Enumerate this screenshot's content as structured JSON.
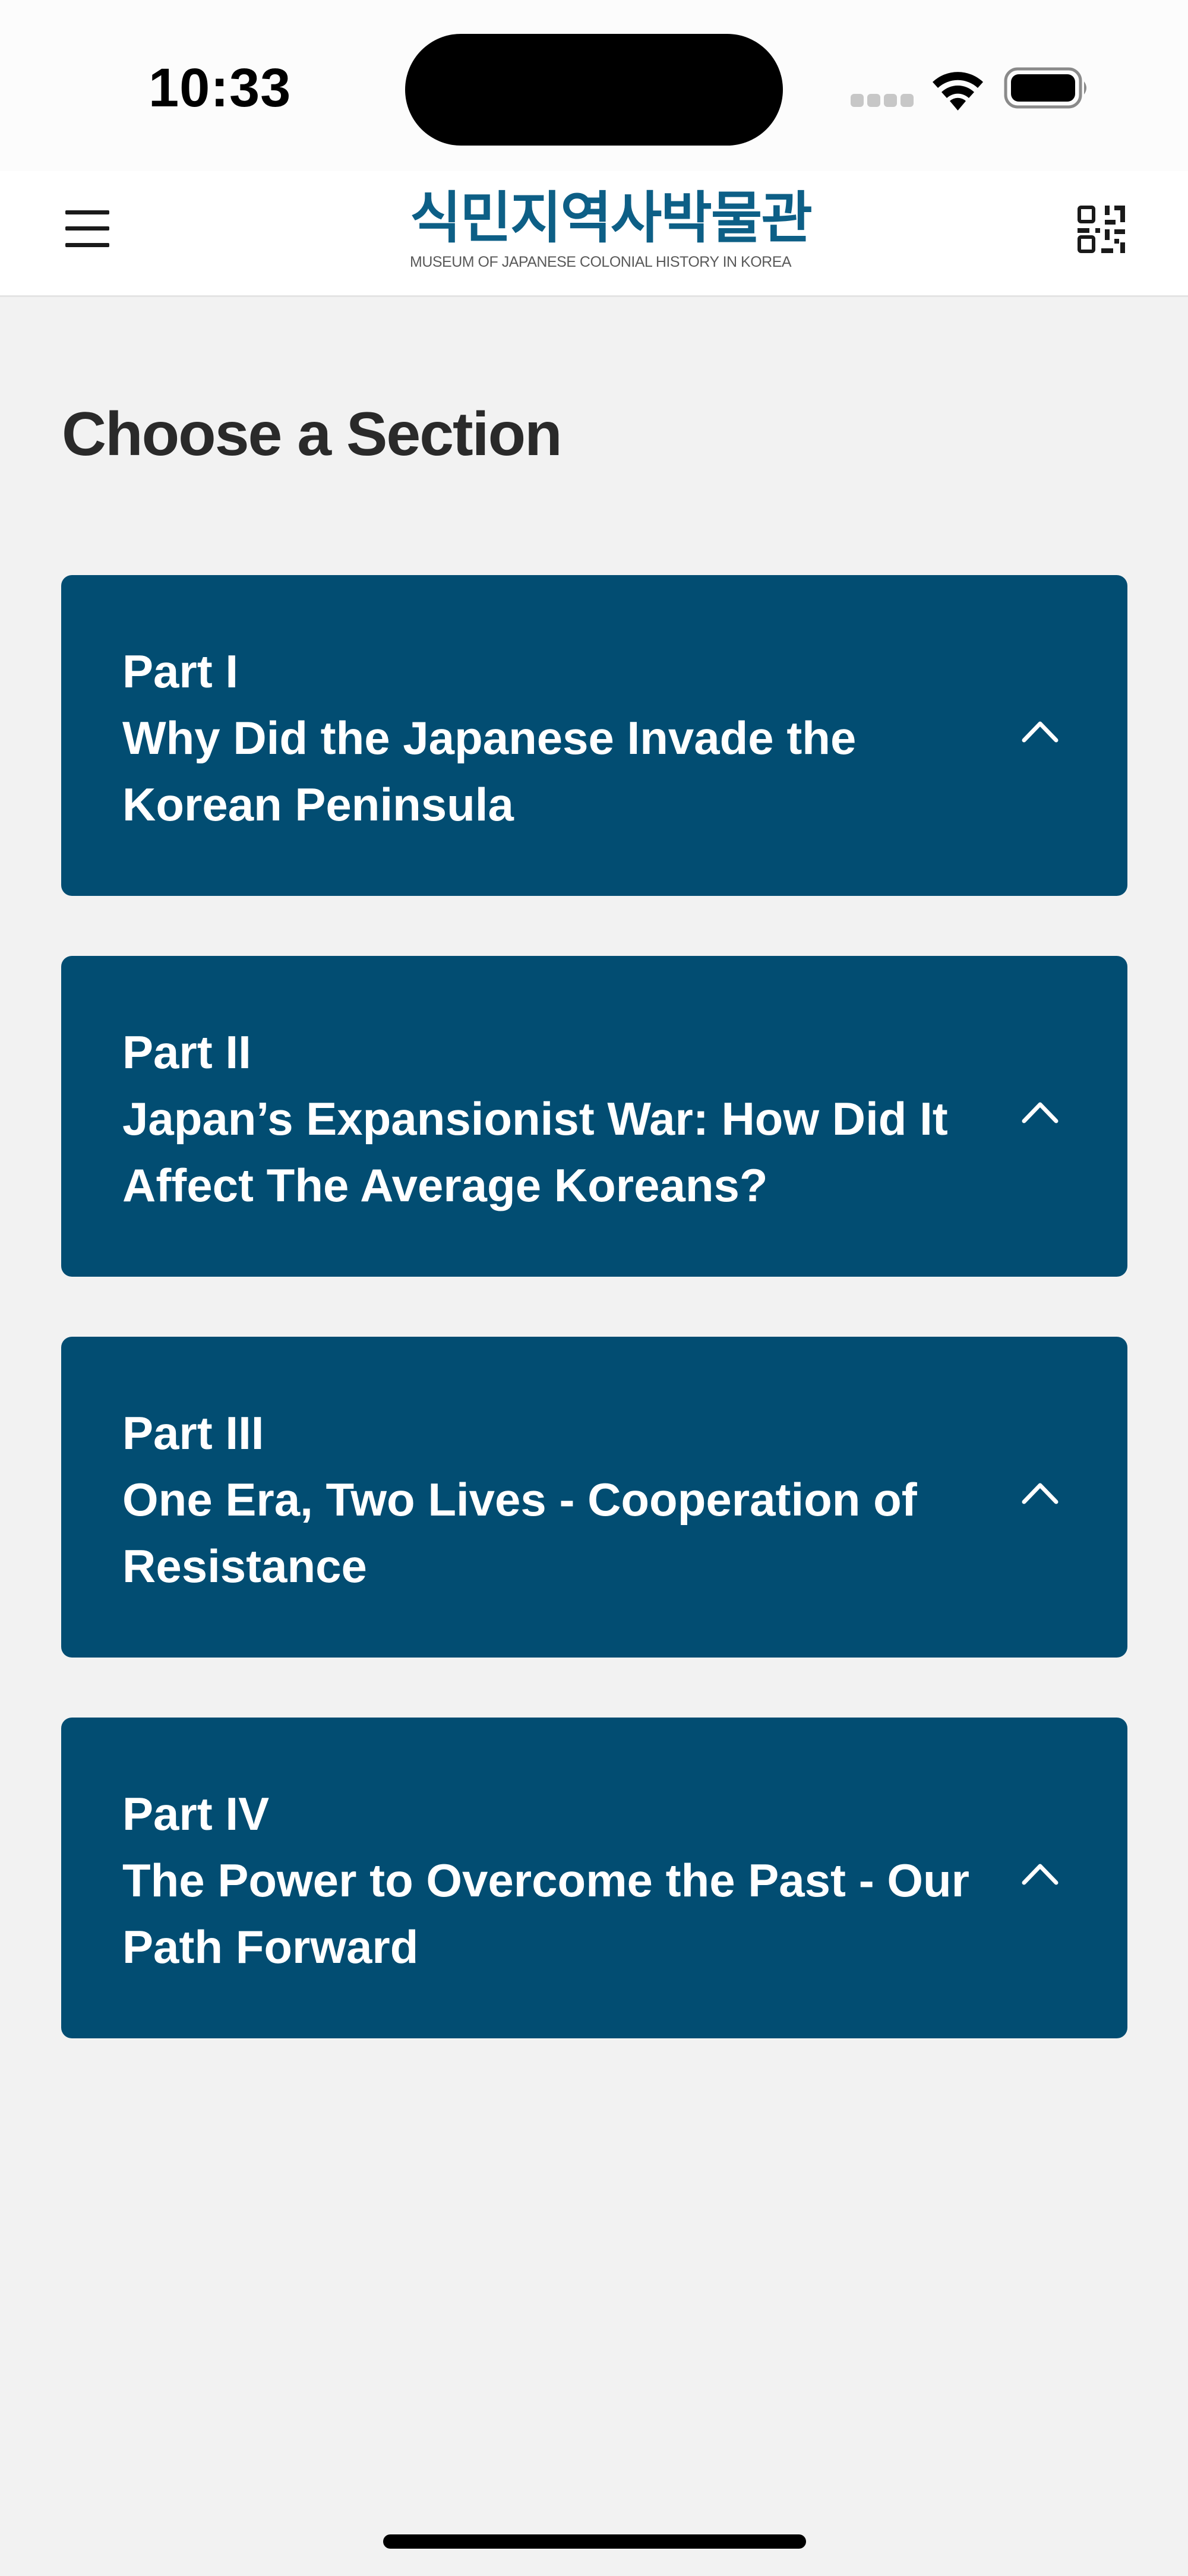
{
  "status_bar": {
    "time": "10:33",
    "icons": [
      "signal-icon",
      "wifi-icon",
      "battery-icon"
    ]
  },
  "header": {
    "menu_icon": "menu-icon",
    "logo_korean": "식민지역사박물관",
    "logo_english": "MUSEUM OF JAPANESE COLONIAL HISTORY IN KOREA",
    "qr_icon": "qr-code-icon",
    "brand_color": "#0d5f86"
  },
  "main": {
    "title": "Choose a Section",
    "card_color": "#024d72",
    "sections": [
      {
        "part": "Part I",
        "title": "Why Did the Japanese Invade the Korean Peninsula",
        "icon": "chevron-up-icon"
      },
      {
        "part": "Part II",
        "title": "Japan’s Expansionist War: How Did It Affect The Average Koreans?",
        "icon": "chevron-up-icon"
      },
      {
        "part": "Part III",
        "title": "One Era, Two Lives - Cooperation of Resistance",
        "icon": "chevron-up-icon"
      },
      {
        "part": "Part IV",
        "title": "The Power to Overcome the Past - Our Path Forward",
        "icon": "chevron-up-icon"
      }
    ]
  }
}
